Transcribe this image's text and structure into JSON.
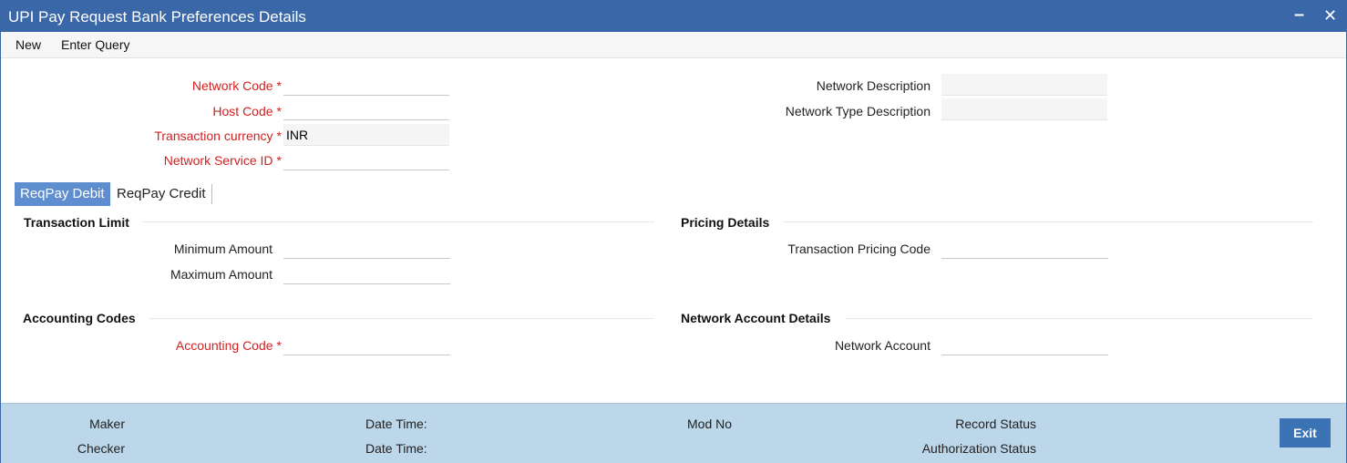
{
  "window": {
    "title": "UPI Pay Request Bank Preferences Details",
    "minimize_glyph": "–",
    "close_glyph": "✕"
  },
  "menu": {
    "new": "New",
    "enter_query": "Enter Query"
  },
  "header": {
    "network_code": {
      "label": "Network Code",
      "value": ""
    },
    "host_code": {
      "label": "Host Code",
      "value": ""
    },
    "transaction_currency": {
      "label": "Transaction currency",
      "value": "INR"
    },
    "network_service_id": {
      "label": "Network Service ID",
      "value": ""
    },
    "network_description": {
      "label": "Network Description",
      "value": ""
    },
    "network_type_description": {
      "label": "Network Type Description",
      "value": ""
    },
    "required_marker": "*"
  },
  "tabs": [
    {
      "label": "ReqPay Debit",
      "active": true
    },
    {
      "label": "ReqPay Credit",
      "active": false
    }
  ],
  "sections": {
    "transaction_limit": {
      "title": "Transaction Limit",
      "minimum_amount": {
        "label": "Minimum Amount",
        "value": ""
      },
      "maximum_amount": {
        "label": "Maximum Amount",
        "value": ""
      }
    },
    "pricing_details": {
      "title": "Pricing Details",
      "transaction_pricing_code": {
        "label": "Transaction Pricing Code",
        "value": ""
      }
    },
    "accounting_codes": {
      "title": "Accounting Codes",
      "accounting_code": {
        "label": "Accounting Code",
        "value": ""
      }
    },
    "network_account_details": {
      "title": "Network Account Details",
      "network_account": {
        "label": "Network Account",
        "value": ""
      }
    }
  },
  "footer": {
    "maker": "Maker",
    "checker": "Checker",
    "date_time_1": "Date Time:",
    "date_time_2": "Date Time:",
    "mod_no": "Mod No",
    "record_status": "Record Status",
    "authorization_status": "Authorization Status",
    "exit": "Exit"
  },
  "colors": {
    "title_bar": "#3a67a8",
    "active_tab": "#5e8ed0",
    "required_label": "#d42020",
    "footer": "#bcd6ea",
    "exit_button": "#3c73b4"
  }
}
